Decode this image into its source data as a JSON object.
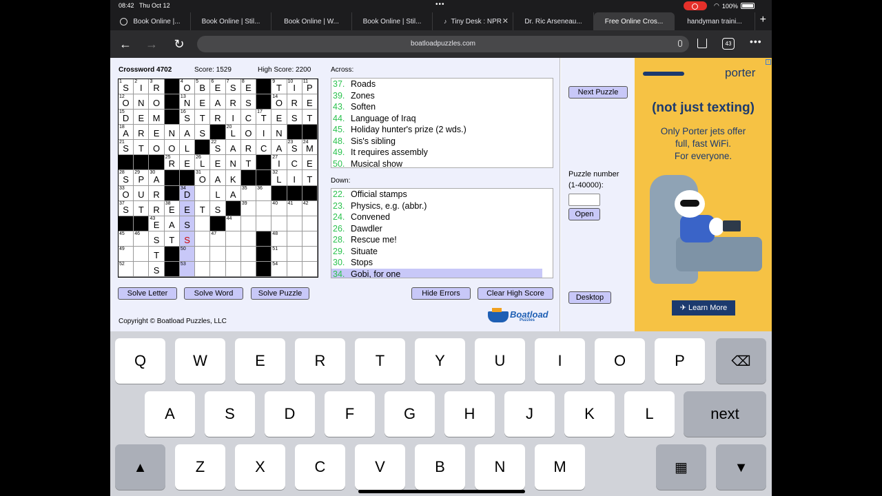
{
  "status": {
    "time": "08:42",
    "date": "Thu Oct 12",
    "battery": "100%"
  },
  "tabs": [
    {
      "label": "Book Online |..."
    },
    {
      "label": "Book Online | Stil..."
    },
    {
      "label": "Book Online | W..."
    },
    {
      "label": "Book Online | Stil..."
    },
    {
      "label": "Tiny Desk : NPR"
    },
    {
      "label": "Dr. Ric Arseneau..."
    },
    {
      "label": "Free Online Cros..."
    },
    {
      "label": "handyman traini..."
    }
  ],
  "toolbar": {
    "url": "boatloadpuzzles.com",
    "tab_count": "43"
  },
  "game": {
    "title": "Crossword 4702",
    "score_label": "Score:  1529",
    "high_score_label": "High Score: 2200",
    "across_label": "Across:",
    "down_label": "Down:",
    "grid": [
      [
        "1|S",
        "2|I",
        "3|R",
        "#",
        "4|O",
        "5|B",
        "6|E",
        "7|S",
        "8|E",
        "#",
        "9|T",
        "10|I",
        "11|P"
      ],
      [
        "12|O",
        "N",
        "O",
        "#",
        "13|N",
        "E",
        "A",
        "R",
        "S",
        "#",
        "14|O",
        "R",
        "E"
      ],
      [
        "15|D",
        "E",
        "M",
        "#",
        "16|S",
        "T",
        "R",
        "I",
        "C",
        "17|T",
        "E",
        "S",
        "T"
      ],
      [
        "18|A",
        "R",
        "E",
        "N",
        "A",
        "S",
        "#",
        "20|L",
        "O",
        "I",
        "N",
        "#",
        "#"
      ],
      [
        "21|S",
        "T",
        "O",
        "O",
        "L",
        "#",
        "22|S",
        "A",
        "R",
        "C",
        "A",
        "23|S",
        "24|M"
      ],
      [
        "#",
        "#",
        "#",
        "25|R",
        "E",
        "26|L",
        "E",
        "N",
        "T",
        "#",
        "27|I",
        "C",
        "E"
      ],
      [
        "28|S",
        "29|P",
        "30|A",
        "#",
        "#",
        "31|O",
        "A",
        "K",
        "#",
        "#",
        "32|L",
        "I",
        "T"
      ],
      [
        "33|O",
        "U",
        "R",
        "#",
        "34|D",
        "*",
        "L",
        "A",
        "35|",
        "36|",
        "#",
        "#",
        "#"
      ],
      [
        "37|S",
        "T",
        "R",
        "38|E",
        "E",
        "T",
        "S",
        "#",
        "39|",
        "*",
        "40|",
        "41|",
        "42|"
      ],
      [
        "#",
        "#",
        "43|E",
        "A",
        "S",
        "*",
        "#",
        "44|",
        "*",
        "*",
        "*",
        "*",
        "*"
      ],
      [
        "45|",
        "46|",
        "S",
        "T",
        "S",
        "*",
        "47|",
        "*",
        "*",
        "#",
        "48|",
        "*",
        "*"
      ],
      [
        "49|",
        "*",
        "T",
        "#",
        "50|",
        "*",
        "*",
        "*",
        "*",
        "#",
        "51|",
        "*",
        "*"
      ],
      [
        "52|",
        "*",
        "S",
        "#",
        "53|",
        "*",
        "*",
        "*",
        "*",
        "#",
        "54|",
        "*",
        "*"
      ]
    ],
    "highlight_col": 4,
    "highlight_rows": [
      7,
      8,
      9,
      10,
      11,
      12
    ],
    "error_cells": [
      "10-4"
    ],
    "across_clues": [
      {
        "num": "37.",
        "text": "Roads"
      },
      {
        "num": "39.",
        "text": "Zones"
      },
      {
        "num": "43.",
        "text": "Soften"
      },
      {
        "num": "44.",
        "text": "Language of Iraq"
      },
      {
        "num": "45.",
        "text": "Holiday hunter's prize (2 wds.)"
      },
      {
        "num": "48.",
        "text": "Sis's sibling"
      },
      {
        "num": "49.",
        "text": "It requires assembly"
      },
      {
        "num": "50.",
        "text": "Musical show"
      }
    ],
    "down_clues": [
      {
        "num": "22.",
        "text": "Official stamps"
      },
      {
        "num": "23.",
        "text": "Physics, e.g. (abbr.)"
      },
      {
        "num": "24.",
        "text": "Convened"
      },
      {
        "num": "26.",
        "text": "Dawdler"
      },
      {
        "num": "28.",
        "text": "Rescue me!"
      },
      {
        "num": "29.",
        "text": "Situate"
      },
      {
        "num": "30.",
        "text": "Stops"
      },
      {
        "num": "34.",
        "text": "Gobi, for one"
      }
    ],
    "selected_down": 7,
    "buttons": {
      "solve_letter": "Solve Letter",
      "solve_word": "Solve Word",
      "solve_puzzle": "Solve Puzzle",
      "hide_errors": "Hide Errors",
      "clear_high_score": "Clear High Score"
    },
    "copyright": "Copyright © Boatload Puzzles, LLC",
    "logo_text": "Boatload",
    "logo_sub": "Puzzles"
  },
  "sidebar": {
    "next_puzzle": "Next Puzzle",
    "puzzle_number_label": "Puzzle number",
    "puzzle_range": "(1-40000):",
    "open": "Open",
    "desktop": "Desktop"
  },
  "ad": {
    "brand": "porter",
    "headline": "(not just texting)",
    "body_line1": "Only Porter jets offer",
    "body_line2": "full, fast WiFi.",
    "body_line3": "For everyone.",
    "cta": "Learn More"
  },
  "keyboard": {
    "row1": [
      "Q",
      "W",
      "E",
      "R",
      "T",
      "Y",
      "U",
      "I",
      "O",
      "P"
    ],
    "row2": [
      "A",
      "S",
      "D",
      "F",
      "G",
      "H",
      "J",
      "K",
      "L"
    ],
    "row3": [
      "Z",
      "X",
      "C",
      "V",
      "B",
      "N",
      "M"
    ],
    "next_label": "next",
    "icons": [
      "shift-icon",
      "backspace-icon",
      "keyboard-layout-icon",
      "dismiss-keyboard-icon"
    ]
  }
}
